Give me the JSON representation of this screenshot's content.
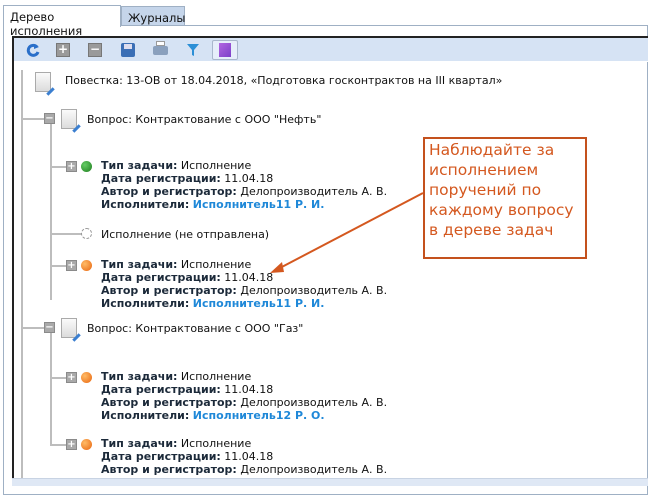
{
  "tabs": [
    {
      "label": "Дерево исполнения",
      "active": true
    },
    {
      "label": "Журналы",
      "active": false
    }
  ],
  "toolbar": {
    "buttons": [
      "refresh-icon",
      "expand-all-icon",
      "collapse-all-icon",
      "save-icon",
      "print-icon",
      "filter-icon",
      "document-icon"
    ]
  },
  "tree": {
    "root": "Повестка: 13-ОВ от 18.04.2018, «Подготовка госконтрактов на III квартал»",
    "labels": {
      "type": "Тип задачи:",
      "date": "Дата регистрации:",
      "author": "Автор и регистратор:",
      "executors": "Исполнители:"
    },
    "questions": [
      {
        "label": "Вопрос: Контрактование с ООО \"Нефть\"",
        "tasks": [
          {
            "status": "green",
            "type": "Исполнение",
            "date": "11.04.18",
            "author": "Делопроизводитель А. В.",
            "executor": "Исполнитель11 Р. И."
          },
          {
            "status": "orange",
            "type": "Исполнение",
            "date": "11.04.18",
            "author": "Делопроизводитель А. В.",
            "executor": "Исполнитель11 Р. И."
          }
        ],
        "unsent": "Исполнение (не отправлена)"
      },
      {
        "label": "Вопрос: Контрактование с ООО \"Газ\"",
        "tasks": [
          {
            "status": "orange",
            "type": "Исполнение",
            "date": "11.04.18",
            "author": "Делопроизводитель А. В.",
            "executor": "Исполнитель12 Р. О."
          },
          {
            "status": "orange",
            "type": "Исполнение",
            "date": "11.04.18",
            "author": "Делопроизводитель А. В."
          }
        ]
      }
    ]
  },
  "callout": "Наблюдайте за исполнением поручений по каждому вопросу в дереве задач",
  "colors": {
    "green": "#2e9a2e",
    "orange": "#f07c1e",
    "accent": "#c4511d",
    "link": "#1f88d8"
  }
}
